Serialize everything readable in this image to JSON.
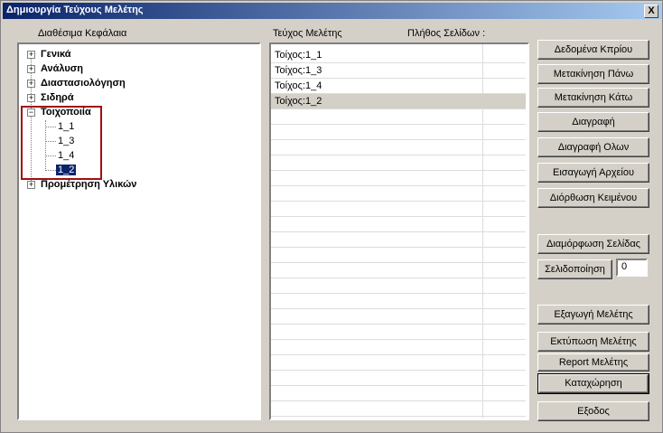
{
  "window": {
    "title": "Δημιουργία Τεύχους Μελέτης",
    "close_label": "X"
  },
  "left": {
    "header": "Διαθέσιμα Κεφάλαια",
    "tree": [
      {
        "label": "Γενικά",
        "expander": "+"
      },
      {
        "label": "Ανάλυση",
        "expander": "+"
      },
      {
        "label": "Διαστασιολόγηση",
        "expander": "+"
      },
      {
        "label": "Σιδηρά",
        "expander": "+"
      },
      {
        "label": "Τοιχοποιία",
        "expander": "−",
        "children": [
          "1_1",
          "1_3",
          "1_4",
          "1_2"
        ]
      },
      {
        "label": "Προμέτρηση Υλικών",
        "expander": "+"
      }
    ]
  },
  "middle": {
    "header_col1": "Τεύχος Μελέτης",
    "header_col2": "Πλήθος Σελίδων :",
    "rows": [
      "Τοίχος:1_1",
      "Τοίχος:1_3",
      "Τοίχος:1_4",
      "Τοίχος:1_2"
    ]
  },
  "buttons": {
    "data_cover": "Δεδομένα Κπρίου",
    "move_up": "Μετακίνηση Πάνω",
    "move_down": "Μετακίνηση Κάτω",
    "delete": "Διαγραφή",
    "delete_all": "Διαγραφή Ολων",
    "import_file": "Εισαγωγή Αρχείου",
    "edit_text": "Διόρθωση Κειμένου",
    "page_setup": "Διαμόρφωση Σελίδας",
    "pagination": "Σελιδοποίηση",
    "pagination_value": "0",
    "export": "Εξαγωγή Μελέτης",
    "print": "Εκτύπωση Μελέτης",
    "report": "Report Μελέτης",
    "register": "Καταχώρηση",
    "exit": "Εξοδος"
  }
}
